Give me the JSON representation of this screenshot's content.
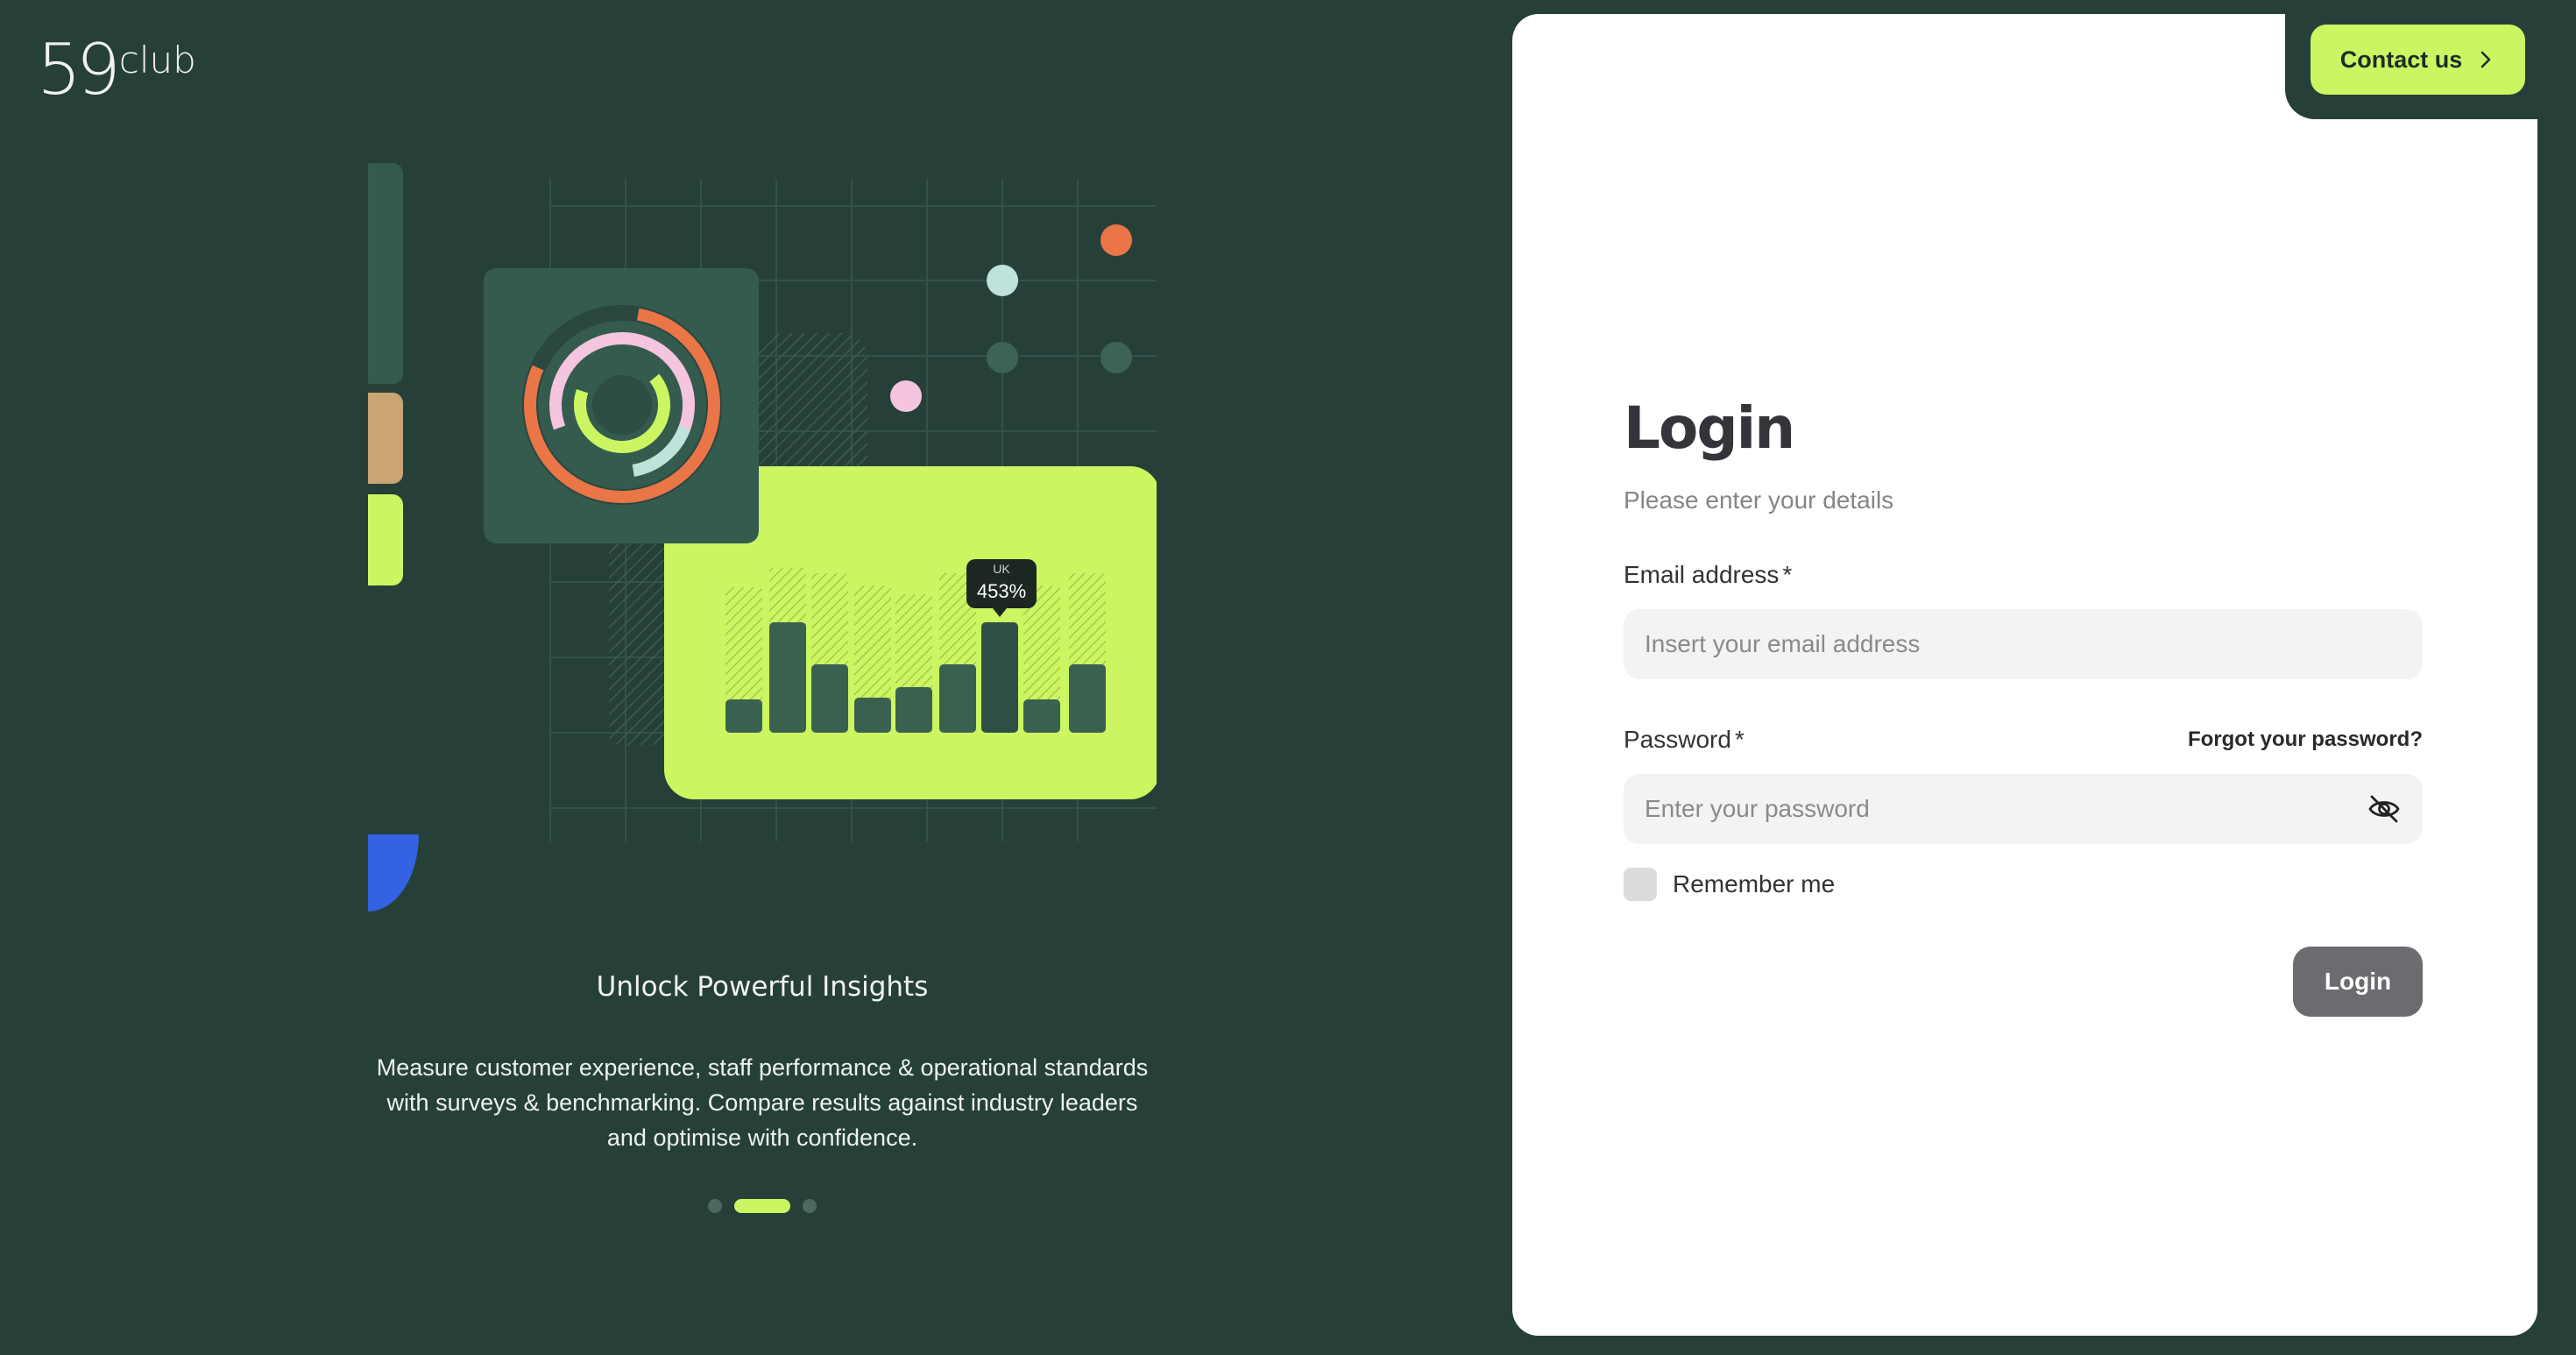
{
  "brand": {
    "logo_number": "59",
    "logo_word": "club"
  },
  "illustration": {
    "tooltip_region": "UK",
    "tooltip_value": "453%"
  },
  "carousel": {
    "title": "Unlock Powerful Insights",
    "text": "Measure customer experience, staff performance & operational standards with surveys & benchmarking. Compare results against industry leaders and optimise with confidence.",
    "active_index": 1,
    "count": 3
  },
  "header": {
    "contact_label": "Contact us"
  },
  "login": {
    "title": "Login",
    "subtitle": "Please enter your details",
    "email_label": "Email address",
    "email_placeholder": "Insert your email address",
    "password_label": "Password",
    "required_mark": "*",
    "forgot_label": "Forgot your password?",
    "password_placeholder": "Enter your password",
    "remember_label": "Remember me",
    "submit_label": "Login"
  },
  "colors": {
    "background": "#264039",
    "accent": "#cbf662",
    "panel": "#ffffff",
    "button_disabled": "#6c6c70"
  }
}
